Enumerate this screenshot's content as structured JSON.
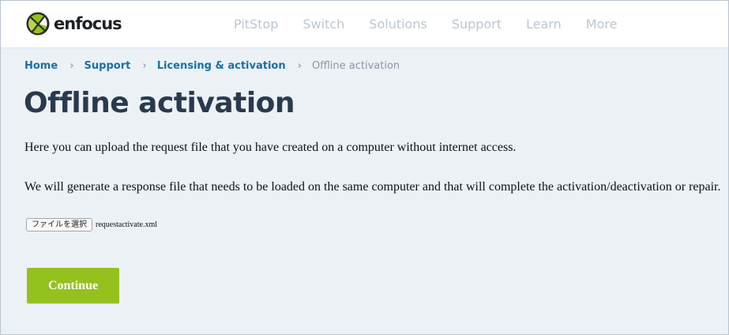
{
  "header": {
    "logo_text": "enfocus",
    "nav": [
      "PitStop",
      "Switch",
      "Solutions",
      "Support",
      "Learn",
      "More"
    ]
  },
  "breadcrumb": {
    "items": [
      "Home",
      "Support",
      "Licensing & activation"
    ],
    "current": "Offline activation",
    "separator": "›"
  },
  "page": {
    "title": "Offline activation",
    "paragraph1": "Here you can upload the request file that you have created on a computer without internet access.",
    "paragraph2": "We will generate a response file that needs to be loaded on the same computer and that will complete the activation/deactivation or repair."
  },
  "file_input": {
    "button_label": "ファイルを選択",
    "file_name": "requestactivate.xml"
  },
  "continue_label": "Continue",
  "colors": {
    "accent_green": "#95c11f",
    "link_blue": "#1a6fa3",
    "title_navy": "#2a3a4e",
    "background": "#ecf1f6"
  }
}
